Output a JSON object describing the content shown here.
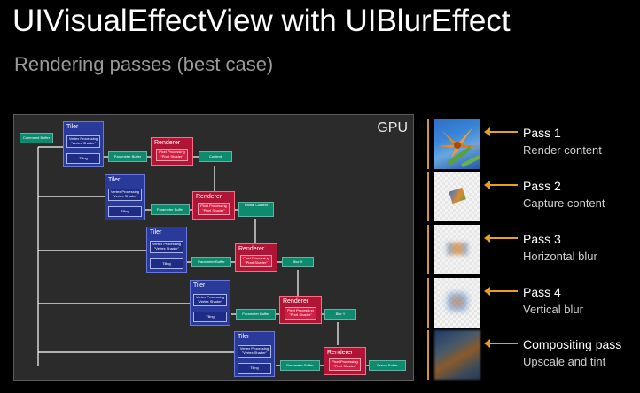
{
  "slide": {
    "title": "UIVisualEffectView with UIBlurEffect",
    "subtitle": "Rendering passes (best case)"
  },
  "gpu": {
    "label": "GPU",
    "command_buffer": "Command Buffer",
    "tiler_label": "Tiler",
    "vertex_processing": "Vertex Processing \"Vertex Shader\"",
    "tiling": "Tiling",
    "parameter_buffer": "Parameter Buffer",
    "renderer_label": "Renderer",
    "pixel_processing": "Pixel Processing \"Pixel Shader\"",
    "outputs": [
      "Content",
      "Partial Content",
      "Blur X",
      "Blur Y",
      "Frame Buffer"
    ]
  },
  "passes": [
    {
      "title": "Pass 1",
      "desc": "Render content"
    },
    {
      "title": "Pass 2",
      "desc": "Capture content"
    },
    {
      "title": "Pass 3",
      "desc": "Horizontal blur"
    },
    {
      "title": "Pass 4",
      "desc": "Vertical blur"
    },
    {
      "title": "Compositing pass",
      "desc": "Upscale and tint"
    }
  ],
  "colors": {
    "accent": "#e8a020",
    "tiler": "#2a3a9a",
    "renderer": "#b01535",
    "buffer": "#0e8a6f"
  }
}
